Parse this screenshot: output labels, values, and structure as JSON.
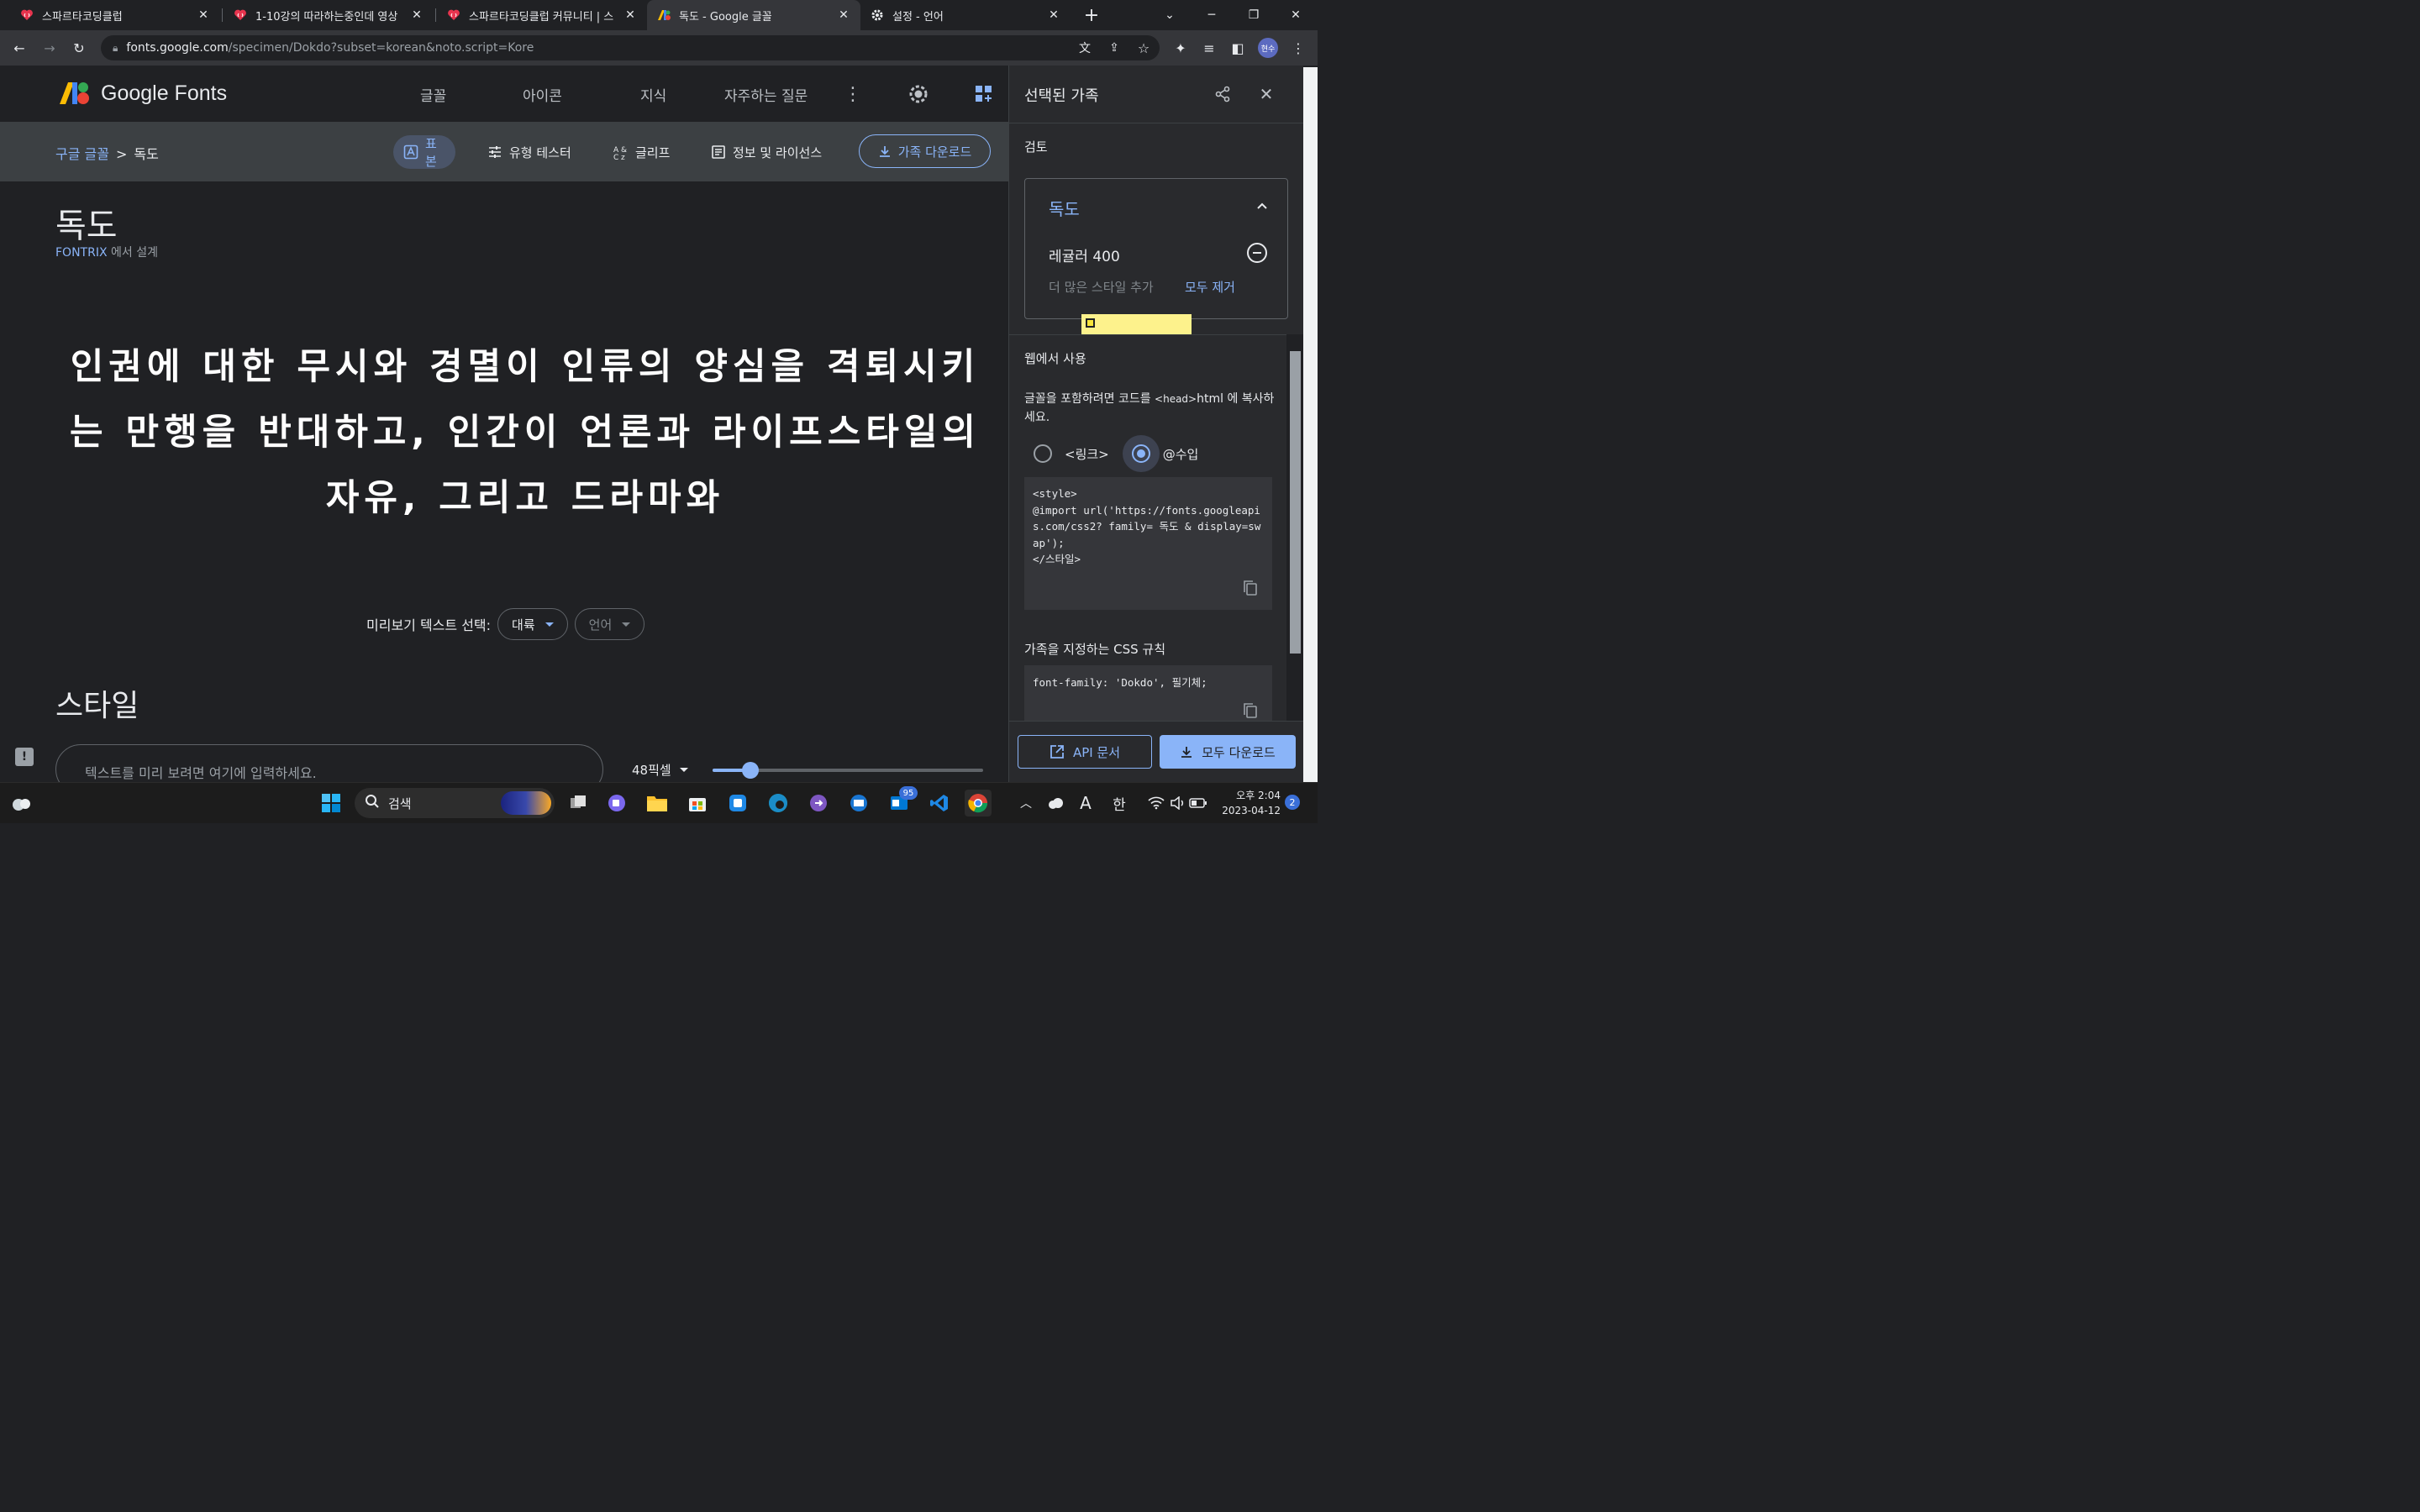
{
  "browser": {
    "tabs": [
      {
        "title": "스파르타코딩클럽"
      },
      {
        "title": "1-10강의 따라하는중인데 영상"
      },
      {
        "title": "스파르타코딩클럽 커뮤니티 | 스"
      },
      {
        "title": "독도 - Google 글꼴"
      },
      {
        "title": "설정 - 언어"
      }
    ],
    "url_host": "fonts.google.com",
    "url_path": "/specimen/Dokdo?subset=korean&noto.script=Kore",
    "profile_initials": "현수"
  },
  "header": {
    "logo_text": "Google Fonts",
    "nav": [
      "글꼴",
      "아이콘",
      "지식",
      "자주하는 질문"
    ]
  },
  "subnav": {
    "breadcrumb_root": "구글 글꼴",
    "breadcrumb_sep": ">",
    "breadcrumb_current": "독도",
    "tabs": [
      "표본",
      "유형 테스터",
      "글리프",
      "정보 및 라이선스"
    ],
    "download_label": "가족 다운로드"
  },
  "specimen": {
    "family_name": "독도",
    "designer_link": "FONTRIX",
    "designer_suffix": "에서 설계",
    "sample_text": "인권에 대한 무시와 경멸이 인류의 양심을 격퇴시키는 만행을 반대하고, 인간이 언론과 라이프스타일의 자유, 그리고 드라마와",
    "preview_label": "미리보기 텍스트 선택:",
    "preview_selected": "대륙",
    "language_placeholder": "언어",
    "styles_heading": "스타일",
    "type_placeholder": "텍스트를 미리 보려면 여기에 입력하세요.",
    "size_label": "48픽셀",
    "size_fraction": 0.14
  },
  "drawer": {
    "title": "선택된 가족",
    "review_heading": "검토",
    "family_name": "독도",
    "style_name": "레귤러 400",
    "add_more": "더 많은 스타일 추가",
    "remove_all": "모두 제거",
    "web_heading": "웹에서 사용",
    "web_desc_1": "글꼴을 포함하려면 코드를 ",
    "web_desc_tag": "<head>",
    "web_desc_2": "html 에 복사하세요.",
    "radio_link": "<링크>",
    "radio_import": "@수입",
    "code_import": "<style>\n@import url('https://fonts.googleapis.com/css2? family= 독도 & display=swap');\n</스타일>",
    "css_heading": "가족을 지정하는 CSS 규칙",
    "code_css": "font-family: 'Dokdo', 필기체;",
    "api_label": "API 문서",
    "download_all_label": "모두 다운로드"
  },
  "taskbar": {
    "search_label": "검색",
    "badge_count": "95",
    "ime_a": "A",
    "ime_han": "한",
    "time": "오후 2:04",
    "date": "2023-04-12",
    "notif_count": "2"
  },
  "colors": {
    "accent": "#8ab4f8",
    "background": "#202124",
    "drawer": "#292a2d"
  }
}
